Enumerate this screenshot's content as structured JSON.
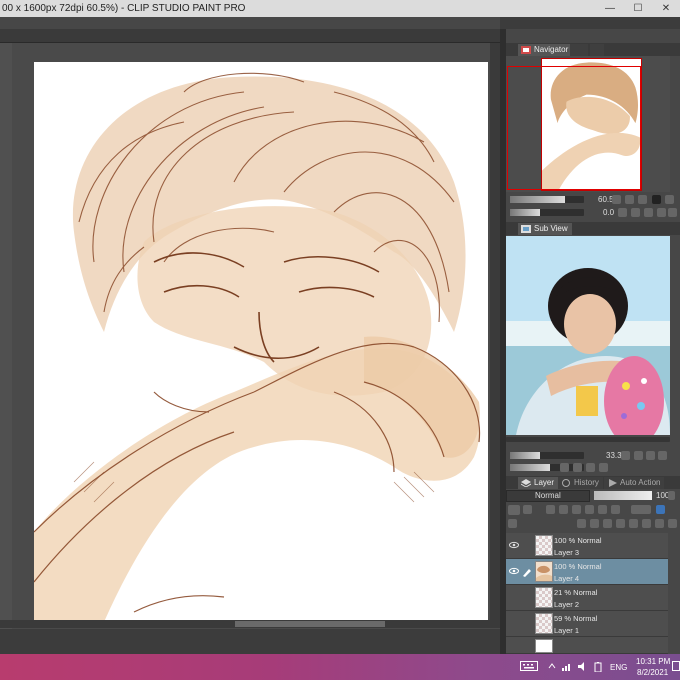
{
  "window": {
    "title": "00 x 1600px 72dpi 60.5%)  - CLIP STUDIO PAINT PRO",
    "min_glyph": "—",
    "max_glyph": "☐",
    "close_glyph": "✕"
  },
  "panels": {
    "navigator": {
      "tab_label": "Navigator",
      "zoom_value": "60.5",
      "rotate_value": "0.0"
    },
    "sub_view": {
      "tab_label": "Sub View",
      "zoom_value": "33.3"
    },
    "layer_tabs": {
      "layer": "Layer",
      "history": "History",
      "auto_action": "Auto Action"
    },
    "layer_props": {
      "blend_mode": "Normal",
      "opacity": "100"
    },
    "layers": [
      {
        "line1": "100 % Normal",
        "line2": "Layer 3",
        "selected": false,
        "visible": true
      },
      {
        "line1": "100 % Normal",
        "line2": "Layer 4",
        "selected": true,
        "visible": true
      },
      {
        "line1": "21 % Normal",
        "line2": "Layer 2",
        "selected": false,
        "visible": false
      },
      {
        "line1": "59 % Normal",
        "line2": "Layer 1",
        "selected": false,
        "visible": false
      }
    ]
  },
  "taskbar": {
    "language": "ENG",
    "time": "10:31 PM",
    "date": "8/2/2021"
  },
  "colors": {
    "sketch": "#8a4a2a",
    "skin": "#e8c6a0",
    "selection_highlight": "#6d8ea2",
    "navigator_frame": "#e00000",
    "taskbar_accent": "#b83c6e"
  },
  "icons": [
    "eye-icon",
    "pen-icon",
    "layer-icon",
    "history-icon",
    "navigator-icon",
    "subview-icon",
    "keyboard-icon",
    "wifi-icon",
    "volume-icon",
    "battery-icon",
    "notification-icon"
  ]
}
